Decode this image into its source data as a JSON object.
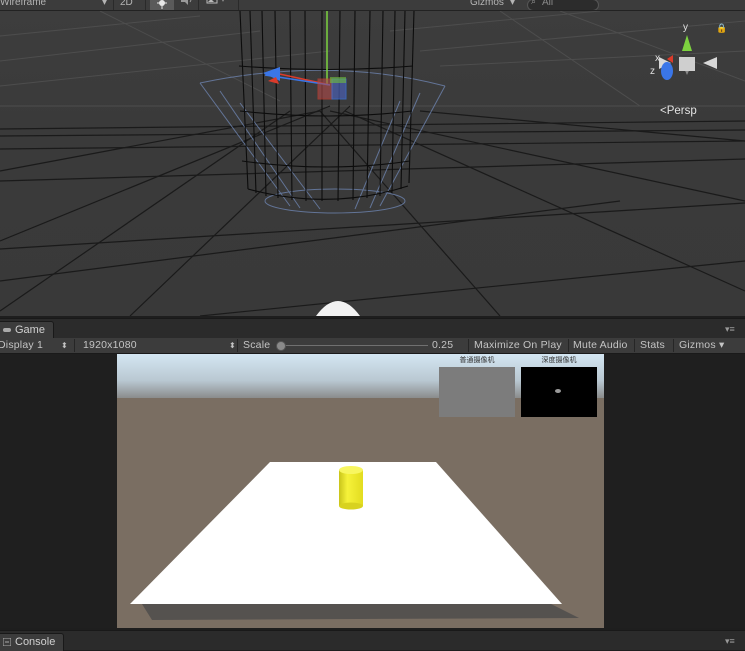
{
  "scene_toolbar": {
    "draw_mode": "Wireframe",
    "mode_2d": "2D",
    "gizmos": "Gizmos",
    "search_placeholder": "All"
  },
  "scene_view": {
    "projection_label": "Persp",
    "axis_y": "y",
    "axis_x": "x",
    "axis_z": "z"
  },
  "game_panel": {
    "tab_label": "Game",
    "display": "Display 1",
    "resolution": "1920x1080",
    "scale_label": "Scale",
    "scale_value": "0.25",
    "maximize_on_play": "Maximize On Play",
    "mute_audio": "Mute Audio",
    "stats": "Stats",
    "gizmos": "Gizmos"
  },
  "game_view": {
    "left_thumbnail_caption": "普通摄像机",
    "right_thumbnail_caption": "深度摄像机"
  },
  "console_panel": {
    "tab_label": "Console"
  },
  "colors": {
    "editor_bg": "#3c3c3c",
    "scene_bg": "#3a3a3a",
    "ground_brown": "#7a6e62",
    "cylinder_yellow": "#f4f030",
    "plane_white": "#ffffff",
    "gizmo_green": "#7dd33f",
    "gizmo_red": "#db3b2b",
    "gizmo_blue": "#3a76e8"
  }
}
